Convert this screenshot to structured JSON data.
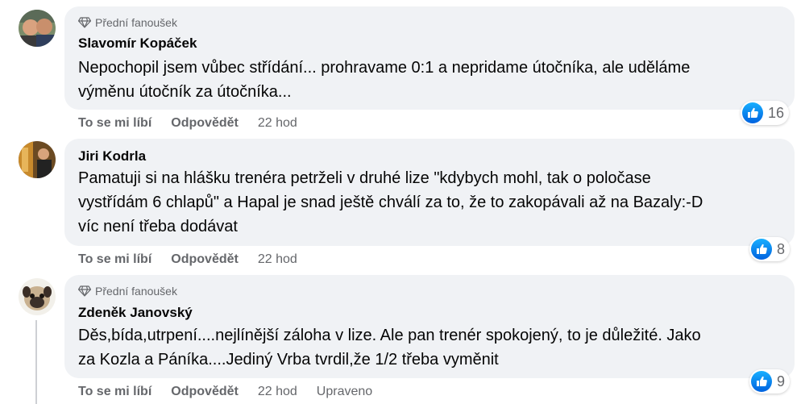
{
  "comments": [
    {
      "badge": "Přední fanoušek",
      "author": "Slavomír Kopáček",
      "text": "Nepochopil jsem vůbec střídání... prohravame 0:1 a nepridame útočníka, ale uděláme\nvýměnu útočník za útočníka...",
      "like_label": "To se mi líbí",
      "reply_label": "Odpovědět",
      "time": "22 hod",
      "reactions": "16"
    },
    {
      "author": "Jiri Kodrla",
      "text": "Pamatuji si na hlášku trenéra petrželi v druhé lize \"kdybych mohl, tak o poločase\nvystřídám 6 chlapů\" a Hapal je snad ještě chválí za to, že to zakopávali až na Bazaly:-D\nvíc není třeba dodávat",
      "like_label": "To se mi líbí",
      "reply_label": "Odpovědět",
      "time": "22 hod",
      "reactions": "8"
    },
    {
      "badge": "Přední fanoušek",
      "author": "Zdeněk Janovský",
      "text": "Děs,bída,utrpení....nejlínější záloha v lize. Ale pan trenér spokojený, to je důležité. Jako\nza Kozla a Páníka....Jediný Vrba tvrdil,že 1/2 třeba vyměnit",
      "like_label": "To se mi líbí",
      "reply_label": "Odpovědět",
      "time": "22 hod",
      "edited": "Upraveno",
      "reactions": "9"
    }
  ],
  "icons": {
    "badge": "diamond-icon",
    "reaction": "like-thumb-icon"
  },
  "colors": {
    "bubble": "#f0f2f5",
    "meta_text": "#65676b",
    "like_blue": "#1877f2"
  }
}
